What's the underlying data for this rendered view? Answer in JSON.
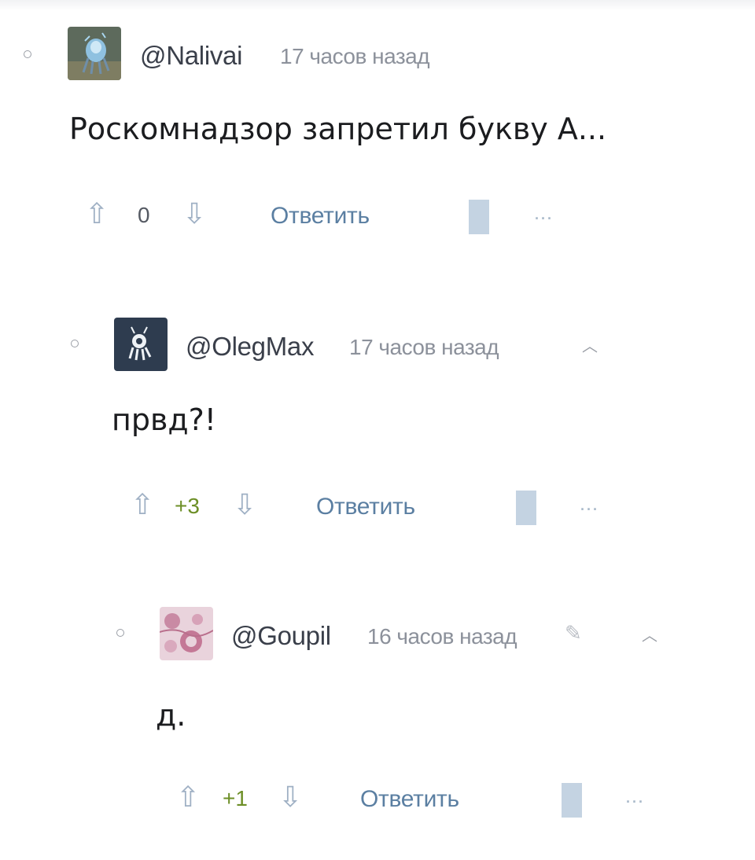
{
  "comments": [
    {
      "username": "@Nalivai",
      "time": "17 часов назад",
      "text": "Роскомнадзор запретил букву А...",
      "score": "0",
      "reply_label": "Ответить",
      "avatar_icon": "creature-avatar",
      "more_icon": "more-dots-icon"
    },
    {
      "username": "@OlegMax",
      "time": "17 часов назад",
      "text": "првд?!",
      "score": "+3",
      "reply_label": "Ответить",
      "avatar_icon": "robot-avatar",
      "collapse_icon": "chevron-up-icon"
    },
    {
      "username": "@Goupil",
      "time": "16 часов назад",
      "text": "д.",
      "score": "+1",
      "reply_label": "Ответить",
      "avatar_icon": "pink-pattern-avatar",
      "edit_icon": "pencil-icon",
      "collapse_icon": "chevron-up-icon"
    }
  ],
  "colors": {
    "reply": "#5b7fa2",
    "positive_score": "#6d8f27",
    "vote_arrow": "#9fb0c4",
    "bookmark": "#c4d3e2"
  }
}
